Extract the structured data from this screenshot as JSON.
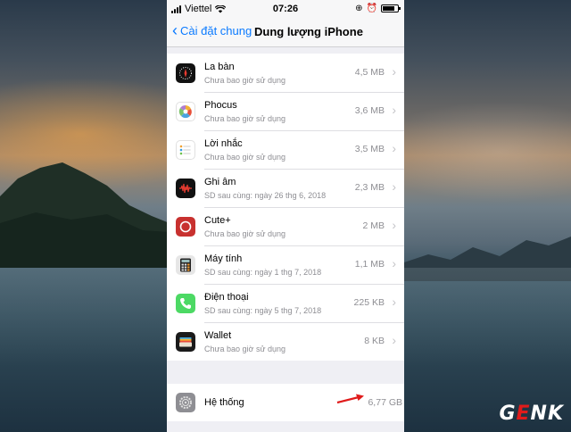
{
  "status_bar": {
    "carrier": "Viettel",
    "time": "07:26",
    "battery_level": 0.8
  },
  "nav": {
    "back_label": "Cài đặt chung",
    "title": "Dung lượng iPhone"
  },
  "apps": [
    {
      "name": "La bàn",
      "subtitle": "Chưa bao giờ sử dụng",
      "size": "4,5 MB",
      "icon": "compass-icon"
    },
    {
      "name": "Phocus",
      "subtitle": "Chưa bao giờ sử dụng",
      "size": "3,6 MB",
      "icon": "phocus-icon"
    },
    {
      "name": "Lời nhắc",
      "subtitle": "Chưa bao giờ sử dụng",
      "size": "3,5 MB",
      "icon": "reminders-icon"
    },
    {
      "name": "Ghi âm",
      "subtitle": "SD sau cùng: ngày 26 thg 6, 2018",
      "size": "2,3 MB",
      "icon": "voice-memo-icon"
    },
    {
      "name": "Cute+",
      "subtitle": "Chưa bao giờ sử dụng",
      "size": "2 MB",
      "icon": "cute-plus-icon"
    },
    {
      "name": "Máy tính",
      "subtitle": "SD sau cùng: ngày 1 thg 7, 2018",
      "size": "1,1 MB",
      "icon": "calculator-icon"
    },
    {
      "name": "Điện thoại",
      "subtitle": "SD sau cùng: ngày 5 thg 7, 2018",
      "size": "225 KB",
      "icon": "phone-icon"
    },
    {
      "name": "Wallet",
      "subtitle": "Chưa bao giờ sử dụng",
      "size": "8 KB",
      "icon": "wallet-icon"
    }
  ],
  "system": {
    "name": "Hệ thống",
    "size": "6,77 GB",
    "icon": "gear-icon"
  },
  "watermark": {
    "prefix": "G",
    "accent": "E",
    "suffix": "NK"
  },
  "colors": {
    "accent": "#0a7aff",
    "arrow": "#e01b1b"
  }
}
